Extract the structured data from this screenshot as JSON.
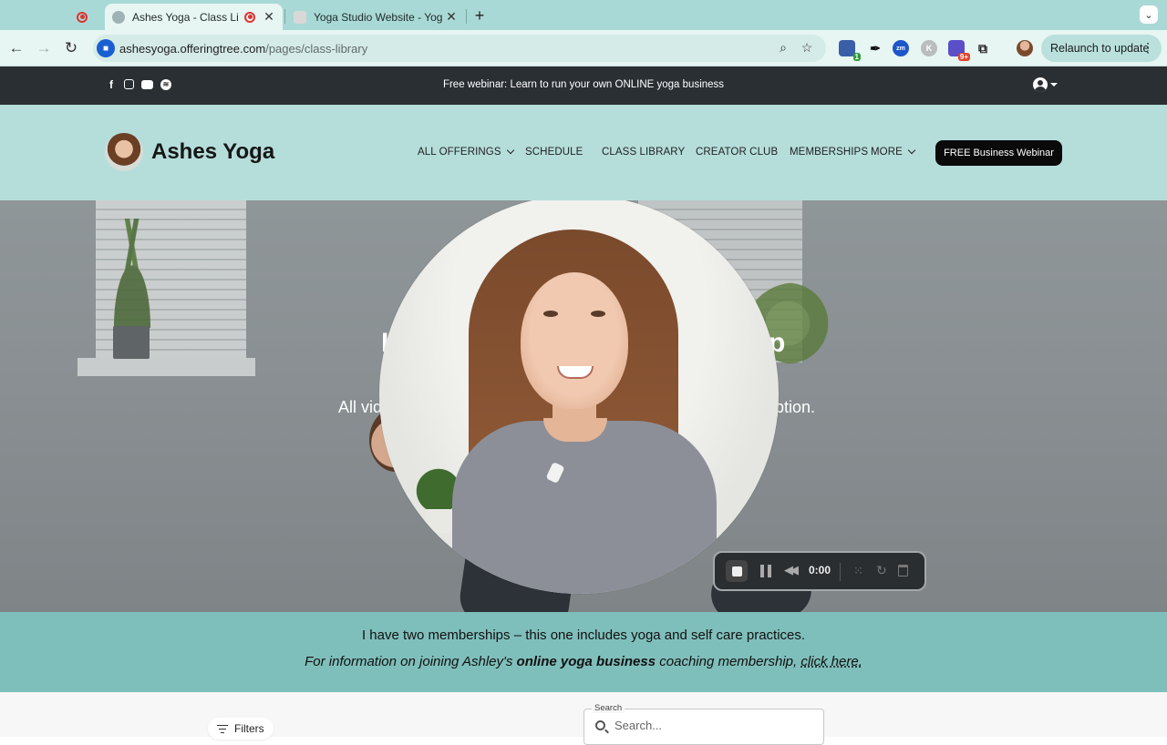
{
  "browser": {
    "tabs": [
      {
        "title": "Ashes Yoga - Class Library",
        "active": true
      },
      {
        "title": "Yoga Studio Website - Yoga P",
        "active": false
      }
    ],
    "new_tab": "+",
    "url_host": "ashesyoga.offeringtree.com",
    "url_path": "/pages/class-library",
    "relaunch_label": "Relaunch to update",
    "extension_badges": {
      "ext1": "1",
      "ext6": "9+"
    },
    "extension_labels": {
      "zm": "zm",
      "k": "K"
    }
  },
  "site": {
    "announcement": "Free webinar: Learn to run your own ONLINE yoga business",
    "brand": "Ashes Yoga",
    "nav": {
      "all_offerings": "ALL OFFERINGS",
      "schedule": "SCHEDULE",
      "class_library": "CLASS LIBRARY",
      "creator_club": "CREATOR CLUB",
      "memberships": "MEMBERSHIPS",
      "more": "MORE"
    },
    "cta": "FREE Business Webinar"
  },
  "hero": {
    "title_left": "I",
    "title_right": "p",
    "subtitle_left": "All vid",
    "subtitle_right": "cription."
  },
  "recorder": {
    "time": "0:00"
  },
  "info": {
    "line1": "I have two memberships – this one includes yoga and self care practices.",
    "line2_pre": "For information on joining Ashley's ",
    "line2_bold": "online yoga business",
    "line2_mid": " coaching membership, ",
    "line2_link": "click here."
  },
  "library": {
    "filters_label": "Filters",
    "search_legend": "Search",
    "search_placeholder": "Search..."
  }
}
